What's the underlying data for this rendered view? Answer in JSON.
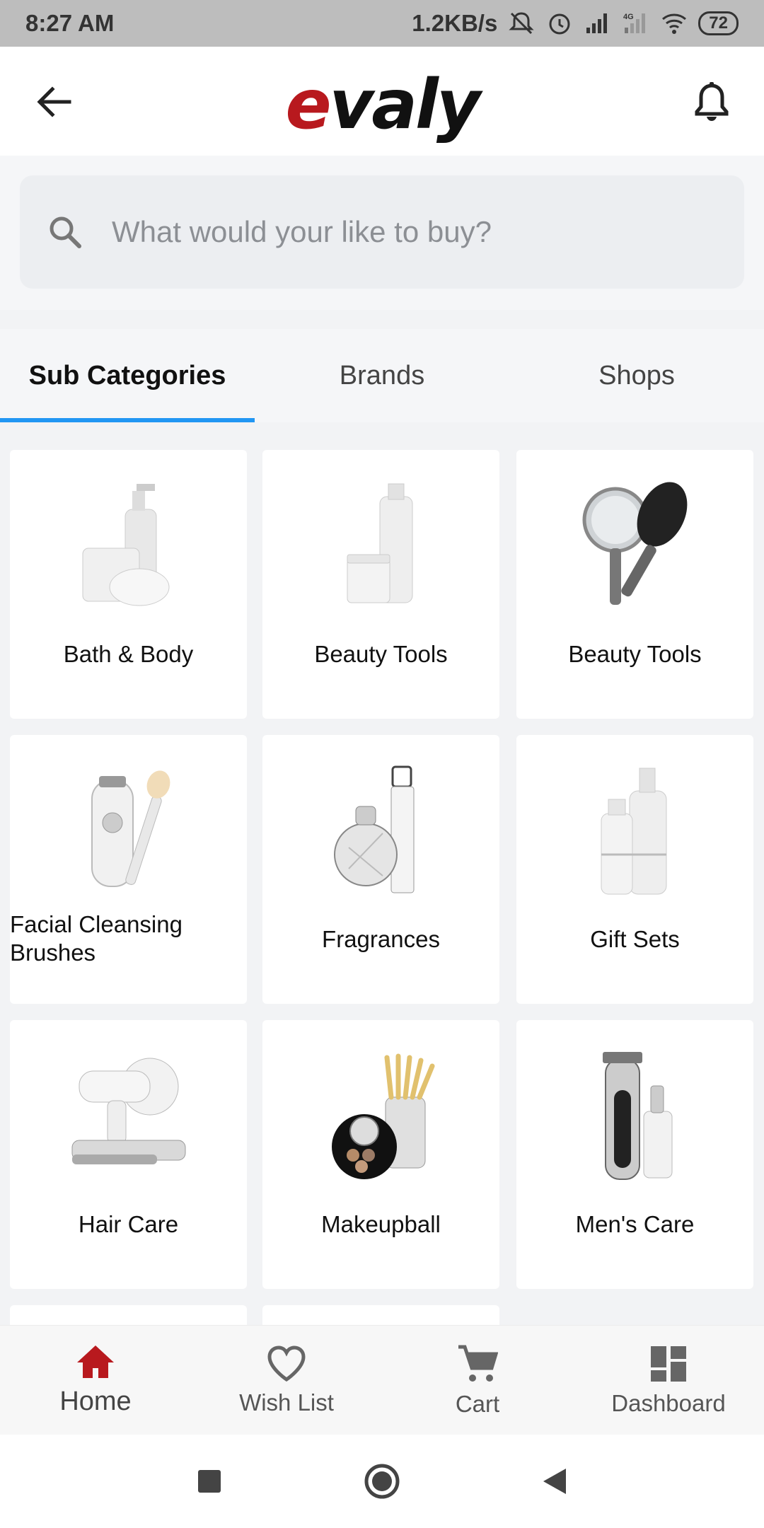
{
  "status_bar": {
    "time": "8:27 AM",
    "network_speed": "1.2KB/s",
    "network_type": "4G",
    "battery": "72"
  },
  "app_bar": {
    "logo_e": "e",
    "logo_rest": "valy",
    "back_icon": "arrow-left-icon",
    "notification_icon": "bell-icon"
  },
  "search": {
    "placeholder": "What would your like to buy?"
  },
  "tabs": [
    {
      "label": "Sub Categories",
      "active": true
    },
    {
      "label": "Brands",
      "active": false
    },
    {
      "label": "Shops",
      "active": false
    }
  ],
  "categories": [
    {
      "label": "Bath & Body"
    },
    {
      "label": "Beauty Tools"
    },
    {
      "label": "Beauty Tools"
    },
    {
      "label": "Facial Cleansing Brushes"
    },
    {
      "label": "Fragrances"
    },
    {
      "label": "Gift Sets"
    },
    {
      "label": "Hair Care"
    },
    {
      "label": "Makeupball"
    },
    {
      "label": "Men's Care"
    }
  ],
  "bottom_nav": [
    {
      "label": "Home",
      "icon": "home-icon",
      "active": true
    },
    {
      "label": "Wish List",
      "icon": "heart-icon",
      "active": false
    },
    {
      "label": "Cart",
      "icon": "cart-icon",
      "active": false
    },
    {
      "label": "Dashboard",
      "icon": "dashboard-icon",
      "active": false
    }
  ],
  "colors": {
    "brand_red": "#b8191e",
    "tab_indicator": "#2196f3",
    "home_active": "#b8191e"
  }
}
